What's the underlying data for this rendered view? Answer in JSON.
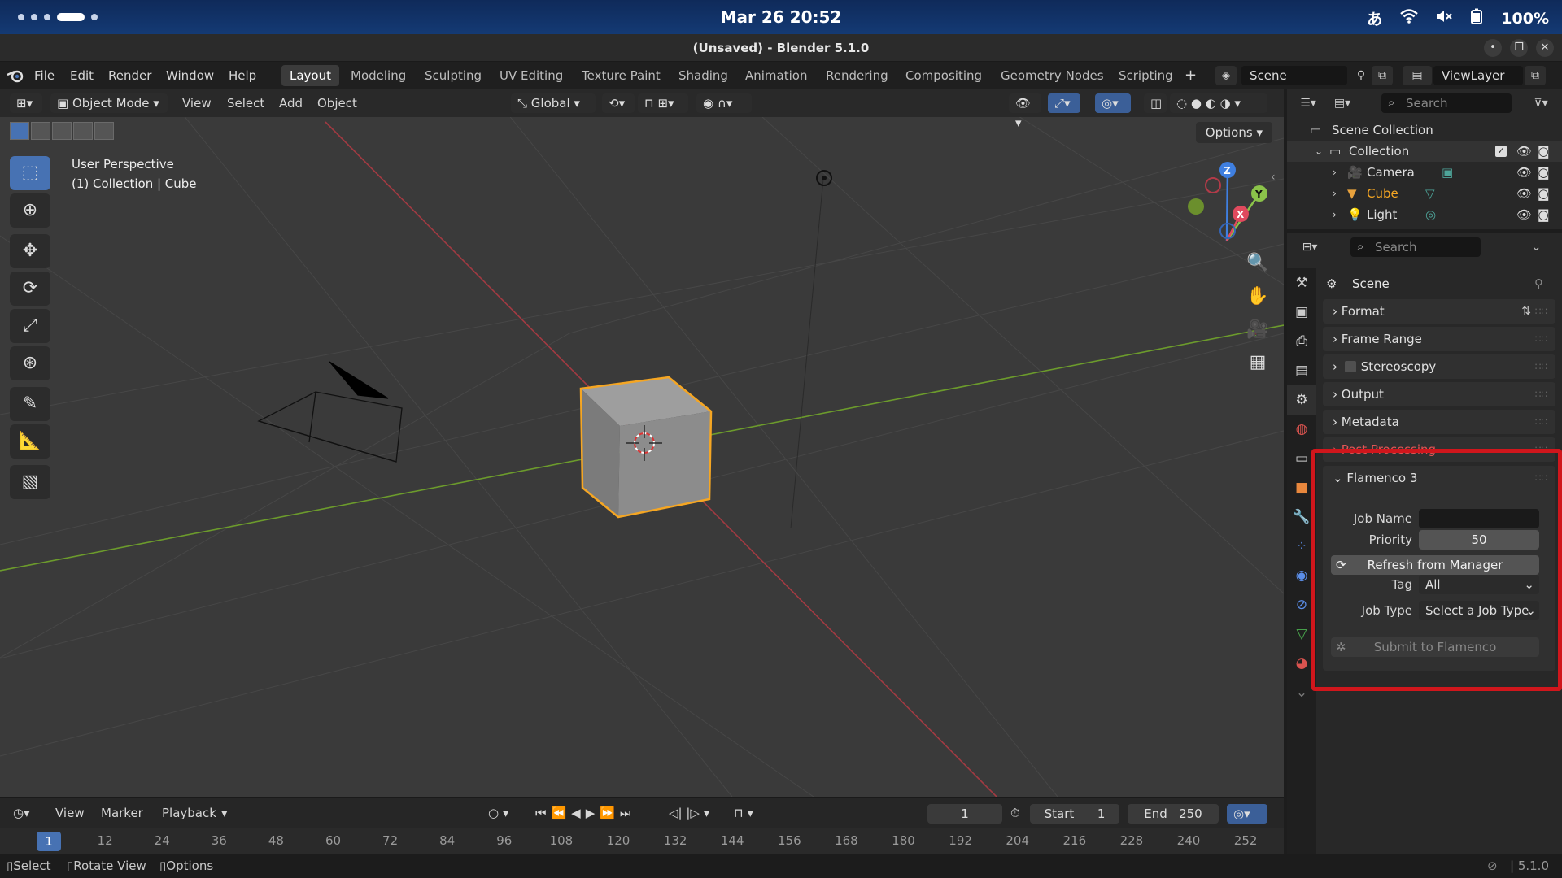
{
  "macos": {
    "clock": "Mar 26  20:52",
    "battery": "100%",
    "input_source": "あ"
  },
  "window": {
    "title": "(Unsaved) - Blender 5.1.0"
  },
  "menus": [
    "File",
    "Edit",
    "Render",
    "Window",
    "Help"
  ],
  "workspaces": [
    "Layout",
    "Modeling",
    "Sculpting",
    "UV Editing",
    "Texture Paint",
    "Shading",
    "Animation",
    "Rendering",
    "Compositing",
    "Geometry Nodes",
    "Scripting"
  ],
  "active_workspace": "Layout",
  "scene_field": "Scene",
  "viewlayer_field": "ViewLayer",
  "viewport": {
    "mode": "Object Mode",
    "header_menus": [
      "View",
      "Select",
      "Add",
      "Object"
    ],
    "transform_orientation": "Global",
    "options_label": "Options",
    "info_line1": "User Perspective",
    "info_line2": "(1) Collection | Cube",
    "gizmo": {
      "z": "Z",
      "y": "Y",
      "x": "X"
    }
  },
  "timeline": {
    "menus": [
      "View",
      "Marker",
      "Playback"
    ],
    "current_frame": "1",
    "start_label": "Start",
    "start_value": "1",
    "end_label": "End",
    "end_value": "250",
    "ruler_current": "1",
    "ruler_ticks": [
      "12",
      "24",
      "36",
      "48",
      "60",
      "72",
      "84",
      "96",
      "108",
      "120",
      "132",
      "144",
      "156",
      "168",
      "180",
      "192",
      "204",
      "216",
      "228",
      "240",
      "252"
    ]
  },
  "statusbar": {
    "select": "Select",
    "rotate": "Rotate View",
    "options": "Options",
    "version": "5.1.0"
  },
  "outliner": {
    "search_placeholder": "Search",
    "scene_collection": "Scene Collection",
    "collection": "Collection",
    "items": [
      "Camera",
      "Cube",
      "Light"
    ]
  },
  "properties": {
    "search_placeholder": "Search",
    "context": "Scene",
    "panels": [
      "Format",
      "Frame Range",
      "Stereoscopy",
      "Output",
      "Metadata",
      "Post Processing"
    ],
    "flamenco": {
      "title": "Flamenco 3",
      "job_name_label": "Job Name",
      "job_name_value": "",
      "priority_label": "Priority",
      "priority_value": "50",
      "refresh_label": "Refresh from Manager",
      "tag_label": "Tag",
      "tag_value": "All",
      "job_type_label": "Job Type",
      "job_type_value": "Select a Job Type",
      "submit_label": "Submit to Flamenco"
    }
  },
  "colors": {
    "accent": "#4772b3",
    "selected_orange": "#f5a623",
    "highlight_red": "#d0161c",
    "x_axis": "#e04a5e",
    "y_axis": "#8bc34a",
    "z_axis": "#3f7fe0"
  }
}
